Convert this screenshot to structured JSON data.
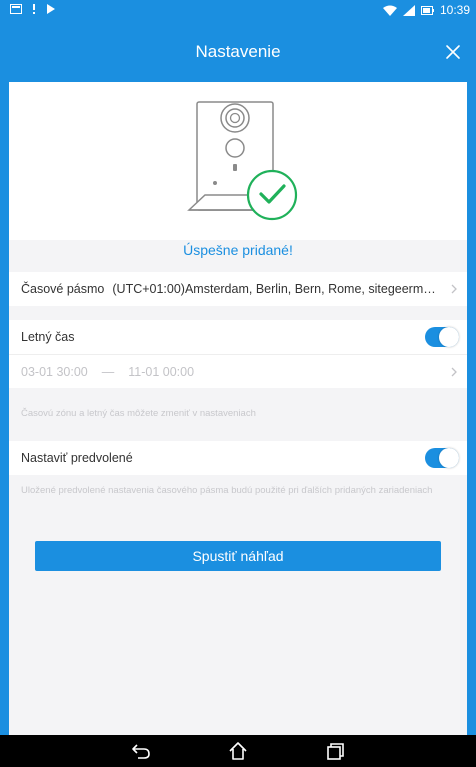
{
  "status_bar": {
    "time": "10:39",
    "icons": [
      "message-icon",
      "notification-icon",
      "play-store-icon",
      "wifi-icon",
      "signal-icon",
      "battery-icon"
    ]
  },
  "header": {
    "title": "Nastavenie",
    "close_icon": "close-icon"
  },
  "success": {
    "message": "Úspešne pridané!",
    "illustration": "camera-success-illustration"
  },
  "settings": {
    "timezone_label": "Časové pásmo",
    "timezone_value": "(UTC+01:00)Amsterdam, Berlin, Bern, Rome, sitegeermo, Vi...",
    "dst_label": "Letný čas",
    "dst_enabled": true,
    "dst_start": "03-01 30:00",
    "dst_separator": "—",
    "dst_end": "11-01 00:00",
    "dst_hint": "Časovú zónu a letný čas môžete zmeniť v nastaveniach",
    "default_label": "Nastaviť predvolené",
    "default_enabled": true,
    "default_hint": "Uložené predvolené nastavenia časového pásma budú použité pri ďalších pridaných zariadeniach"
  },
  "preview_button": "Spustiť náhľad",
  "nav_bar": {
    "icons": [
      "back-icon",
      "home-icon",
      "recent-apps-icon"
    ]
  },
  "colors": {
    "accent": "#1b8fe0",
    "success_green": "#20b15a",
    "background": "#f4f4f6"
  }
}
